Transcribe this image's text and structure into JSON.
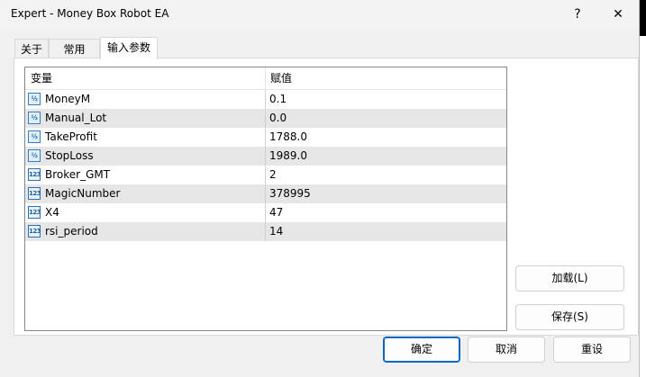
{
  "window": {
    "title": "Expert - Money Box Robot EA"
  },
  "titlebar": {
    "help_label": "?",
    "close_label": "✕"
  },
  "tabs": [
    {
      "label": "关于"
    },
    {
      "label": "常用"
    },
    {
      "label": "输入参数"
    }
  ],
  "table": {
    "columns": [
      "变量",
      "赋值"
    ],
    "rows": [
      {
        "icon": "double-type-icon",
        "icon_text": "½",
        "name": "MoneyM",
        "value": "0.1"
      },
      {
        "icon": "double-type-icon",
        "icon_text": "½",
        "name": "Manual_Lot",
        "value": "0.0"
      },
      {
        "icon": "double-type-icon",
        "icon_text": "½",
        "name": "TakeProfit",
        "value": "1788.0"
      },
      {
        "icon": "double-type-icon",
        "icon_text": "½",
        "name": "StopLoss",
        "value": "1989.0"
      },
      {
        "icon": "integer-type-icon",
        "icon_text": "123",
        "name": "Broker_GMT",
        "value": "2"
      },
      {
        "icon": "integer-type-icon",
        "icon_text": "123",
        "name": "MagicNumber",
        "value": "378995"
      },
      {
        "icon": "integer-type-icon",
        "icon_text": "123",
        "name": "X4",
        "value": "47"
      },
      {
        "icon": "integer-type-icon",
        "icon_text": "123",
        "name": "rsi_period",
        "value": "14"
      }
    ]
  },
  "buttons": {
    "load": "加载(L)",
    "save": "保存(S)",
    "ok": "确定",
    "cancel": "取消",
    "reset": "重设"
  },
  "colors": {
    "primary_border": "#0067c0",
    "alt_row": "#e6e6e6"
  }
}
